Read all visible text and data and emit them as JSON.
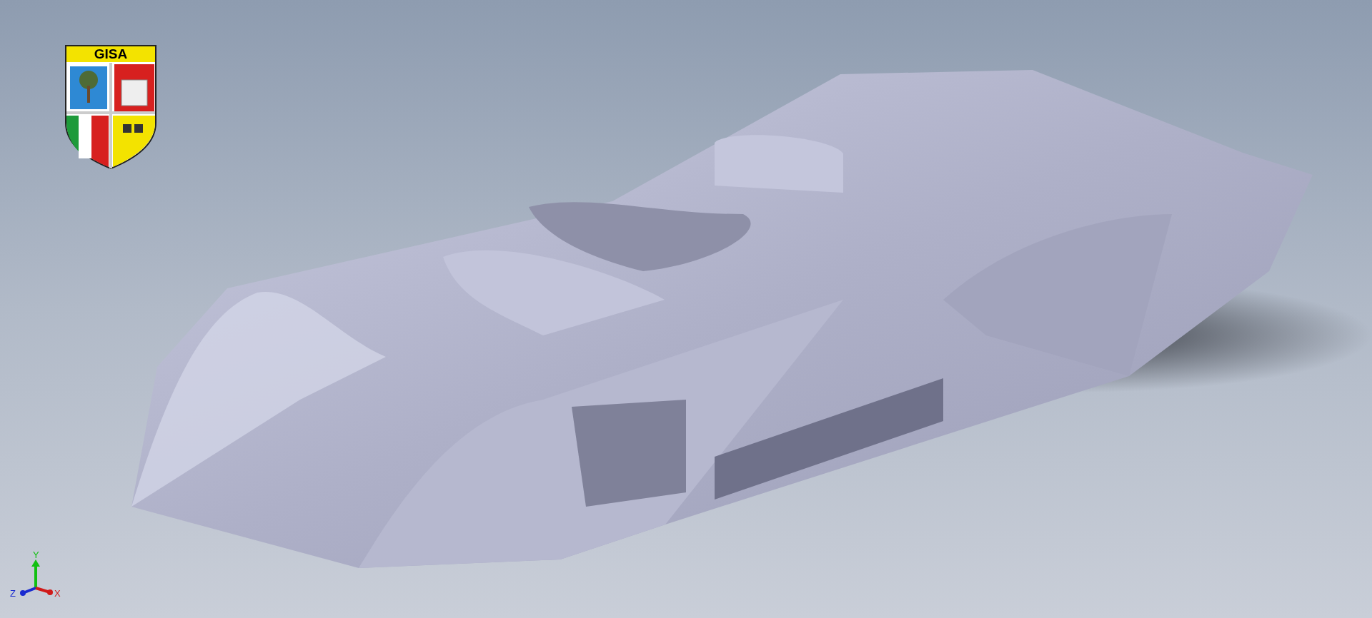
{
  "logo": {
    "text": "GISA"
  },
  "axis_triad": {
    "x_label": "X",
    "y_label": "Y",
    "z_label": "Z"
  }
}
